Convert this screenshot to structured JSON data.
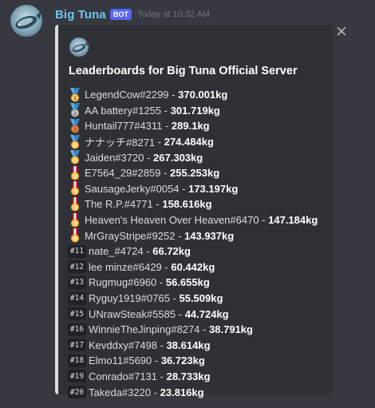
{
  "message": {
    "username": "Big Tuna",
    "bot_tag": "BOT",
    "timestamp": "Today at 10:32 AM"
  },
  "embed": {
    "title": "Leaderboards for Big Tuna Official Server",
    "close_glyph": "×",
    "accent_color": "#dcddde",
    "rows": [
      {
        "medal": "gold-medal",
        "name": "LegendCow#2299",
        "sep": " - ",
        "score": "370.001kg"
      },
      {
        "medal": "silver-medal",
        "name": "AA battery#1255",
        "sep": " - ",
        "score": "301.719kg"
      },
      {
        "medal": "bronze-medal",
        "name": "Huntail777#4311",
        "sep": " - ",
        "score": "289.1kg"
      },
      {
        "medal": "military-medal",
        "name": "ナナッチ#8271",
        "sep": " - ",
        "score": "274.484kg"
      },
      {
        "medal": "military-medal",
        "name": "Jaiden#3720",
        "sep": " - ",
        "score": "267.303kg"
      },
      {
        "medal": "ribbon-medal",
        "name": "E7564_29#2859",
        "sep": " - ",
        "score": "255.253kg"
      },
      {
        "medal": "ribbon-medal",
        "name": "SausageJerky#0054",
        "sep": " - ",
        "score": "173.197kg"
      },
      {
        "medal": "ribbon-medal",
        "name": "The R.P.#4771",
        "sep": " - ",
        "score": "158.616kg"
      },
      {
        "medal": "ribbon-medal",
        "name": "Heaven's Heaven Over Heaven#6470",
        "sep": " - ",
        "score": "147.184kg"
      },
      {
        "medal": "ribbon-medal",
        "name": "MrGrayStripe#9252",
        "sep": " - ",
        "score": "143.937kg"
      },
      {
        "rank": "#11",
        "name": "nate_#4724",
        "sep": " - ",
        "score": "66.72kg"
      },
      {
        "rank": "#12",
        "name": "lee minze#6429",
        "sep": " - ",
        "score": "60.442kg"
      },
      {
        "rank": "#13",
        "name": "Rugmug#6960",
        "sep": " - ",
        "score": "56.655kg"
      },
      {
        "rank": "#14",
        "name": "Ryguy1919#0765",
        "sep": " - ",
        "score": "55.509kg"
      },
      {
        "rank": "#15",
        "name": "UNrawSteak#5585",
        "sep": " - ",
        "score": "44.724kg"
      },
      {
        "rank": "#16",
        "name": "WinnieTheJinping#8274",
        "sep": " - ",
        "score": "38.791kg"
      },
      {
        "rank": "#17",
        "name": "Kevddxy#7498",
        "sep": " - ",
        "score": "38.614kg"
      },
      {
        "rank": "#18",
        "name": "Elmo11#5690",
        "sep": " - ",
        "score": "36.723kg"
      },
      {
        "rank": "#19",
        "name": "Conrado#7131",
        "sep": " - ",
        "score": "28.733kg"
      },
      {
        "rank": "#20",
        "name": "Takeda#3220",
        "sep": " - ",
        "score": "23.816kg"
      }
    ]
  },
  "colors": {
    "background": "#36393f",
    "embed_background": "#2f3136",
    "username": "#6dc7ef",
    "bot_tag": "#5865f2",
    "rank_badge": "#202225"
  }
}
